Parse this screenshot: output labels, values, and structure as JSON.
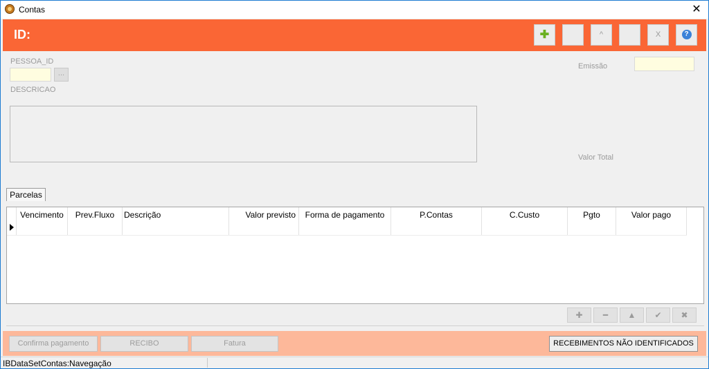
{
  "window": {
    "title": "Contas",
    "close_glyph": "✕"
  },
  "header": {
    "id_label": "ID:"
  },
  "toolbar": {
    "buttons": [
      {
        "name": "add-button",
        "glyph": "✚",
        "icon": "plus-icon"
      },
      {
        "name": "blank-button-1",
        "glyph": ""
      },
      {
        "name": "up-button",
        "glyph": "^"
      },
      {
        "name": "blank-button-2",
        "glyph": ""
      },
      {
        "name": "cancel-button",
        "glyph": "X"
      },
      {
        "name": "help-button",
        "glyph": "?",
        "icon": "help-icon"
      }
    ]
  },
  "form": {
    "pessoa_label": "PESSOA_ID",
    "dots_label": "...",
    "descricao_label": "DESCRICAO",
    "emissao_label": "Emissão",
    "valor_total_label": "Valor Total"
  },
  "tabs": {
    "parcelas": "Parcelas"
  },
  "grid": {
    "columns": [
      "Vencimento",
      "Prev.Fluxo",
      "Descrição",
      "Valor previsto",
      "Forma de pagamento",
      "P.Contas",
      "C.Custo",
      "Pgto",
      "Valor pago"
    ]
  },
  "navigator": {
    "buttons": [
      {
        "name": "nav-insert-button",
        "glyph": "✚",
        "icon": "plus-icon"
      },
      {
        "name": "nav-delete-button",
        "glyph": "━",
        "icon": "minus-icon"
      },
      {
        "name": "nav-edit-button",
        "glyph": "▲",
        "icon": "up-triangle-icon"
      },
      {
        "name": "nav-post-button",
        "glyph": "✔",
        "icon": "check-icon"
      },
      {
        "name": "nav-cancel-button",
        "glyph": "✖",
        "icon": "x-icon"
      }
    ]
  },
  "footer": {
    "confirma_label": "Confirma pagamento",
    "recibo_label": "RECIBO",
    "fatura_label": "Fatura",
    "recebimentos_label": "RECEBIMENTOS NÃO IDENTIFICADOS"
  },
  "status": {
    "text": "IBDataSetContas:Navegação"
  },
  "colors": {
    "header": "#fa6635",
    "footer": "#fdb89a",
    "input_bg": "#fffde0"
  }
}
